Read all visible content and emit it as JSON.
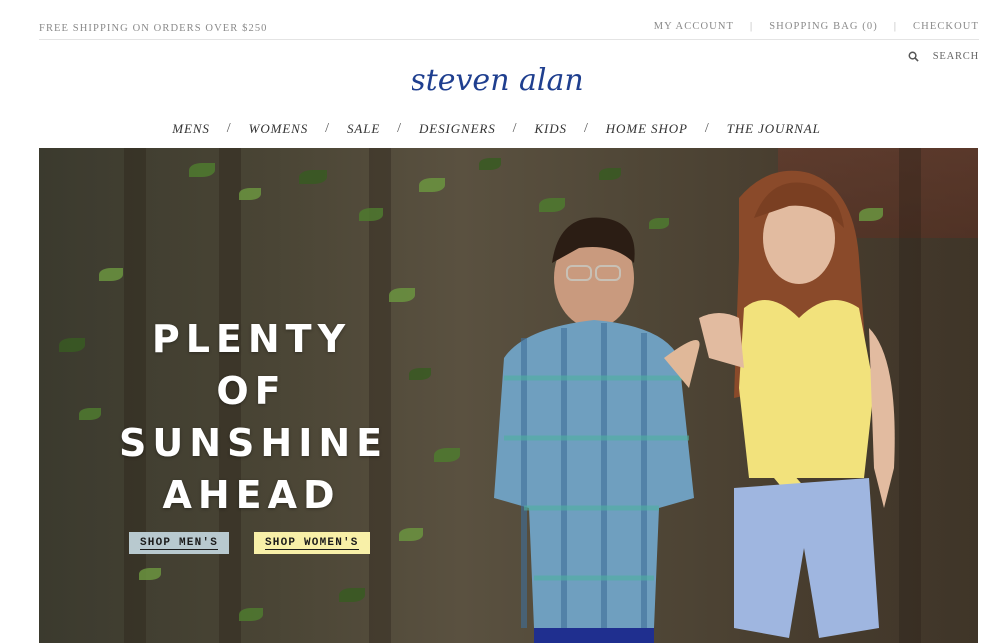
{
  "topbar": {
    "promo": "FREE SHIPPING ON ORDERS OVER $250",
    "my_account": "MY ACCOUNT",
    "shopping_bag": "SHOPPING BAG (0)",
    "checkout": "CHECKOUT",
    "separator": "|"
  },
  "search": {
    "label": "SEARCH",
    "icon": "search-icon"
  },
  "logo": {
    "text": "steven alan",
    "color": "#1f3f8f"
  },
  "nav": {
    "separator": "/",
    "items": [
      "MENS",
      "WOMENS",
      "SALE",
      "DESIGNERS",
      "KIDS",
      "HOME SHOP",
      "THE JOURNAL"
    ]
  },
  "hero": {
    "headline": [
      "PLENTY",
      "OF",
      "SUNSHINE",
      "AHEAD"
    ],
    "cta_men": "SHOP MEN'S",
    "cta_women": "SHOP WOMEN'S",
    "cta_men_color": "#b8c9cf",
    "cta_women_color": "#f8f0a8"
  }
}
